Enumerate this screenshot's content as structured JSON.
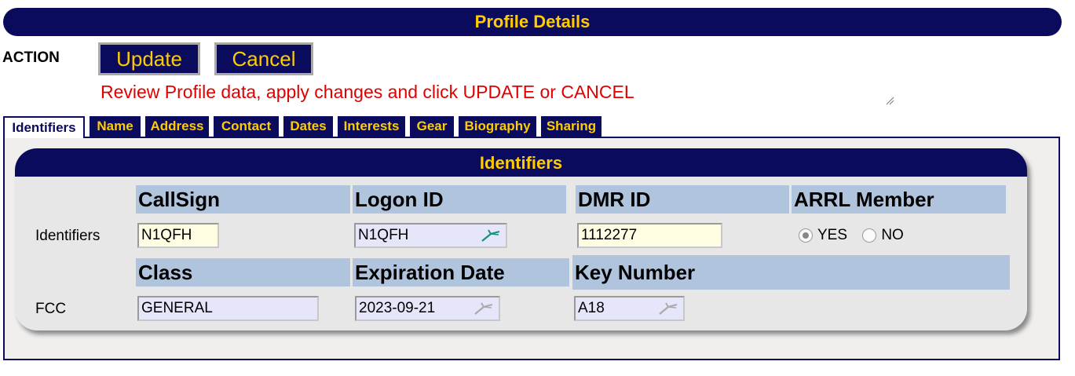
{
  "header": {
    "title": "Profile Details"
  },
  "action": {
    "label": "ACTION",
    "update_label": "Update",
    "cancel_label": "Cancel",
    "message": "Review Profile data, apply changes and click UPDATE or CANCEL"
  },
  "tabs": [
    {
      "label": "Identifiers",
      "active": true
    },
    {
      "label": "Name"
    },
    {
      "label": "Address"
    },
    {
      "label": "Contact"
    },
    {
      "label": "Dates"
    },
    {
      "label": "Interests"
    },
    {
      "label": "Gear"
    },
    {
      "label": "Biography"
    },
    {
      "label": "Sharing"
    }
  ],
  "section": {
    "title": "Identifiers",
    "row1": {
      "label": "Identifiers",
      "callsign": {
        "header": "CallSign",
        "value": "N1QFH"
      },
      "logon": {
        "header": "Logon ID",
        "value": "N1QFH",
        "icon": "pencil-icon"
      },
      "dmr": {
        "header": "DMR ID",
        "value": "1112277"
      },
      "arrl": {
        "header": "ARRL Member",
        "yes_label": "YES",
        "no_label": "NO",
        "selected": "YES"
      }
    },
    "row2": {
      "label": "FCC",
      "class": {
        "header": "Class",
        "value": "GENERAL"
      },
      "expiration": {
        "header": "Expiration Date",
        "value": "2023-09-21",
        "icon": "pencil-icon"
      },
      "key": {
        "header": "Key Number",
        "value": "A18",
        "icon": "pencil-icon"
      }
    }
  },
  "colors": {
    "navy": "#0b0b5e",
    "gold": "#ffcc00",
    "header_blue": "#b0c4de",
    "message_red": "#e00000"
  }
}
